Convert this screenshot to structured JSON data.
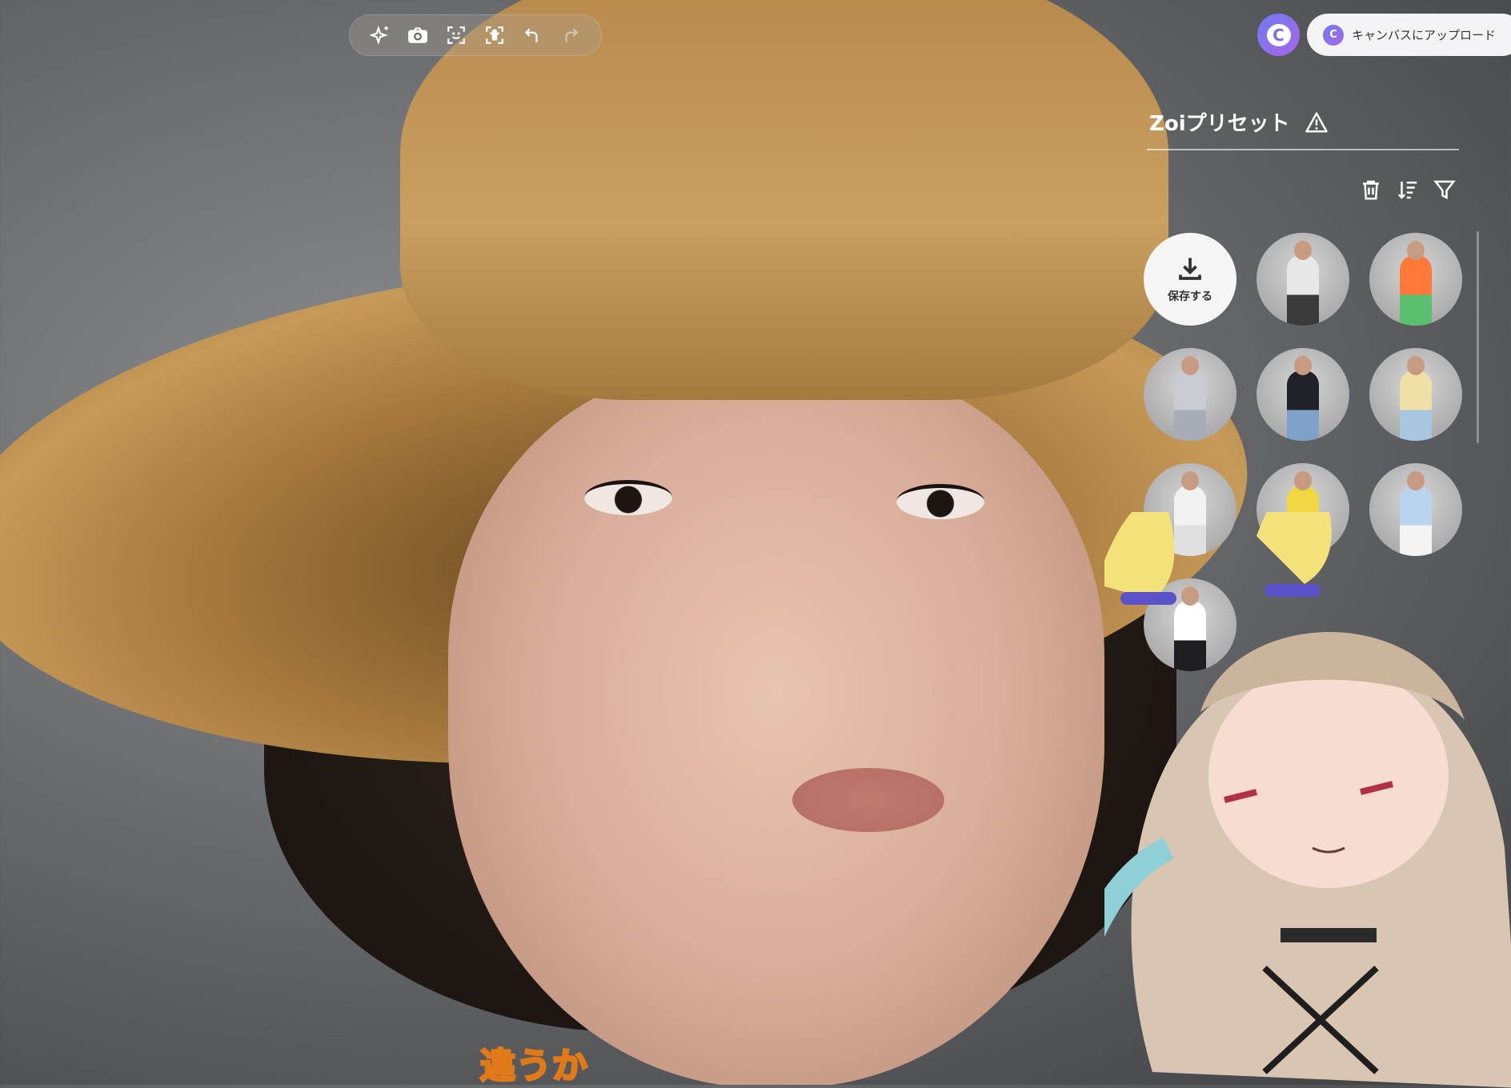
{
  "toolbar": {
    "items": [
      {
        "icon": "sparkle-icon",
        "label": "AI"
      },
      {
        "icon": "camera-icon",
        "label": "Screenshot"
      },
      {
        "icon": "face-frame-icon",
        "label": "Face focus"
      },
      {
        "icon": "body-frame-icon",
        "label": "Body focus"
      },
      {
        "icon": "undo-icon",
        "label": "Undo"
      },
      {
        "icon": "redo-icon",
        "label": "Redo"
      }
    ]
  },
  "header": {
    "upload_label": "キャンバスにアップロード",
    "logo_letter": "C"
  },
  "panel": {
    "title": "Zoiプリセット",
    "save_label": "保存する",
    "presets": [
      {
        "top": "#e8e8e8",
        "bottom": "#3a3a3a"
      },
      {
        "top": "#ff7a3a",
        "bottom": "#5ac070"
      },
      {
        "top": "#c9ccd2",
        "bottom": "#a8adb5"
      },
      {
        "top": "#1f2226",
        "bottom": "#7fa0c8"
      },
      {
        "top": "#efe0a8",
        "bottom": "#a9c6e0"
      },
      {
        "top": "#f2f2f2",
        "bottom": "#e0e0e0"
      },
      {
        "top": "#f0d640",
        "bottom": "#6e8fb0"
      },
      {
        "top": "#b9d4ec",
        "bottom": "#f4f4f4"
      },
      {
        "top": "#ffffff",
        "bottom": "#1e1e22"
      }
    ]
  },
  "subtitle": "違うか"
}
